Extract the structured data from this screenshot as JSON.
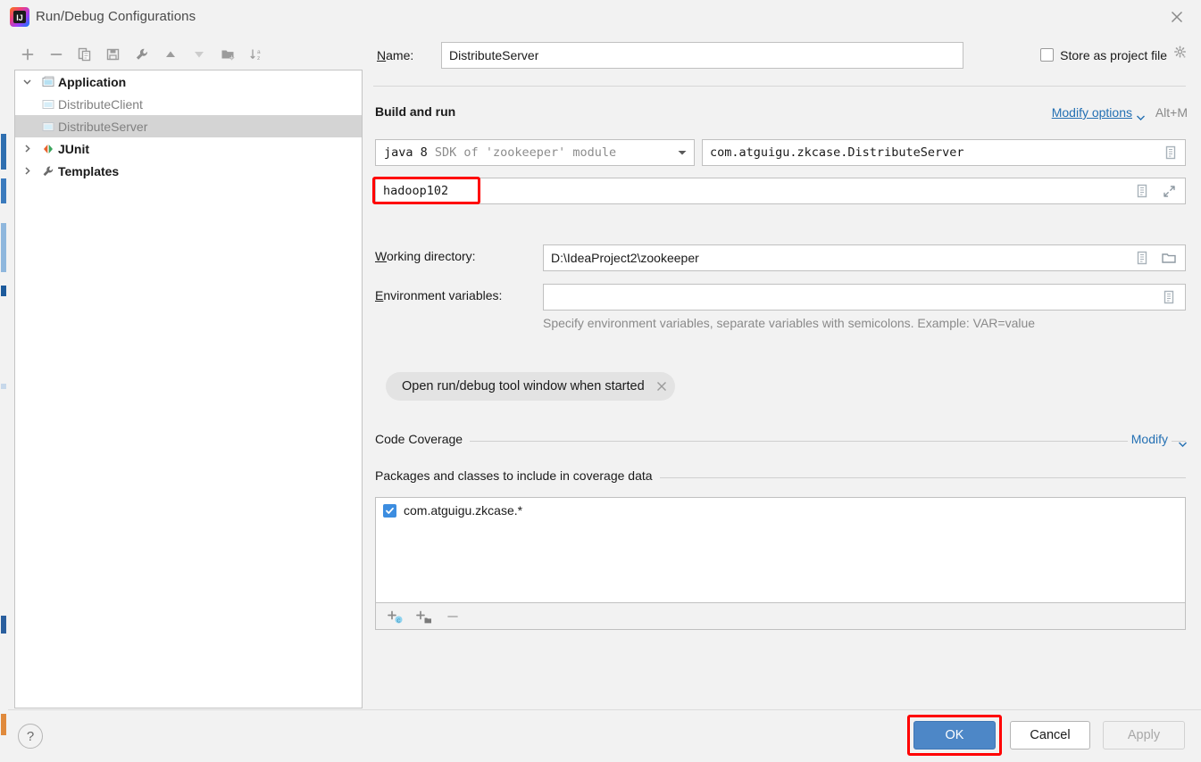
{
  "window": {
    "title": "Run/Debug Configurations",
    "app_icon": "intellij-idea-logo",
    "close_icon": "close-icon"
  },
  "tree_toolbar": {
    "buttons": [
      {
        "name": "add-configuration-button",
        "icon": "plus-icon",
        "label": "+"
      },
      {
        "name": "remove-configuration-button",
        "icon": "minus-icon",
        "label": "−"
      },
      {
        "name": "copy-configuration-button",
        "icon": "copy-icon",
        "label": "Copy"
      },
      {
        "name": "save-configuration-button",
        "icon": "save-icon",
        "label": "Save"
      },
      {
        "name": "edit-templates-button",
        "icon": "wrench-icon",
        "label": "Edit Templates"
      },
      {
        "name": "move-up-button",
        "icon": "arrow-up-icon",
        "label": "Move Up"
      },
      {
        "name": "move-down-button",
        "icon": "arrow-down-icon",
        "label": "Move Down"
      },
      {
        "name": "new-folder-button",
        "icon": "folder-add-icon",
        "label": "New Folder"
      },
      {
        "name": "sort-alphabetically-button",
        "icon": "sort-az-icon",
        "label": "Sort Alphabetically"
      }
    ]
  },
  "tree": {
    "items": [
      {
        "label": "Application",
        "type": "group",
        "expanded": true,
        "icon": "application-icon"
      },
      {
        "label": "DistributeClient",
        "type": "child",
        "selected": false,
        "icon": "application-icon"
      },
      {
        "label": "DistributeServer",
        "type": "child",
        "selected": true,
        "icon": "application-icon"
      },
      {
        "label": "JUnit",
        "type": "group",
        "expanded": false,
        "icon": "junit-icon"
      },
      {
        "label": "Templates",
        "type": "group",
        "expanded": false,
        "icon": "wrench-icon"
      }
    ]
  },
  "form": {
    "name_label": "Name:",
    "name_value": "DistributeServer",
    "store_as_project_file_label": "Store as project file",
    "store_as_project_file_checked": false,
    "store_gear_icon": "gear-icon",
    "build_and_run_title": "Build and run",
    "modify_options_label": "Modify options",
    "modify_options_shortcut": "Alt+M",
    "sdk_value_prefix": "java 8",
    "sdk_value_suffix": "SDK of 'zookeeper' module",
    "main_class_value": "com.atguigu.zkcase.DistributeServer",
    "program_arguments_value": "hadoop102",
    "working_directory_label": "Working directory:",
    "working_directory_value": "D:\\IdeaProject2\\zookeeper",
    "environment_variables_label": "Environment variables:",
    "environment_variables_value": "",
    "environment_hint": "Specify environment variables, separate variables with semicolons. Example: VAR=value",
    "option_chip_label": "Open run/debug tool window when started",
    "option_chip_close_icon": "close-icon"
  },
  "code_coverage": {
    "section_title": "Code Coverage",
    "modify_label": "Modify",
    "packages_title": "Packages and classes to include in coverage data",
    "entries": [
      {
        "label": "com.atguigu.zkcase.*",
        "checked": true
      }
    ],
    "toolbar": [
      {
        "name": "add-class-button",
        "icon": "add-class-icon"
      },
      {
        "name": "add-package-button",
        "icon": "add-package-icon"
      },
      {
        "name": "remove-entry-button",
        "icon": "minus-icon"
      }
    ]
  },
  "footer": {
    "help_label": "?",
    "ok_label": "OK",
    "cancel_label": "Cancel",
    "apply_label": "Apply"
  },
  "colors": {
    "accent_blue": "#4d87c7",
    "link_blue": "#2470b3",
    "annotation_red": "#ff0000",
    "selection_gray": "#d4d4d4",
    "dialog_bg": "#f2f2f2"
  }
}
